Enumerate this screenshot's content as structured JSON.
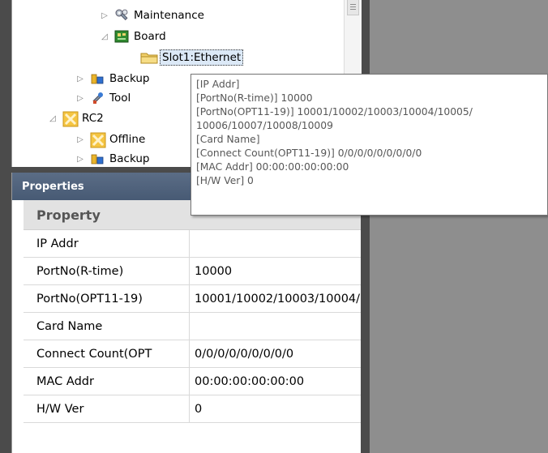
{
  "tree": {
    "items": [
      {
        "label": "Maintenance",
        "icon": "maintenance-icon",
        "expander": "collapsed"
      },
      {
        "label": "Board",
        "icon": "board-icon",
        "expander": "expanded"
      },
      {
        "label": "Slot1:Ethernet",
        "icon": "folder-icon",
        "expander": "none",
        "selected": true
      },
      {
        "label": "Backup",
        "icon": "backup-icon",
        "expander": "collapsed"
      },
      {
        "label": "Tool",
        "icon": "tool-icon",
        "expander": "collapsed"
      },
      {
        "label": "RC2",
        "icon": "robot-controller-icon",
        "expander": "expanded"
      },
      {
        "label": "Offline",
        "icon": "offline-icon",
        "expander": "collapsed"
      },
      {
        "label": "Backup",
        "icon": "backup-icon",
        "expander": "collapsed"
      }
    ]
  },
  "properties": {
    "title": "Properties",
    "column_header": "Property",
    "rows": [
      {
        "name": "IP Addr",
        "value": ""
      },
      {
        "name": "PortNo(R-time)",
        "value": "10000"
      },
      {
        "name": "PortNo(OPT11-19)",
        "value": "10001/10002/10003/10004/10005/10006/10007/10008/10009"
      },
      {
        "name": "Card Name",
        "value": ""
      },
      {
        "name": "Connect Count(OPT",
        "value": "0/0/0/0/0/0/0/0/0"
      },
      {
        "name": "MAC Addr",
        "value": "00:00:00:00:00:00"
      },
      {
        "name": "H/W Ver",
        "value": "0"
      }
    ]
  },
  "tooltip": {
    "lines": [
      "[IP Addr]",
      "[PortNo(R-time)]  10000",
      "[PortNo(OPT11-19)]  10001/10002/10003/10004/10005/",
      "10006/10007/10008/10009",
      "[Card Name]",
      "[Connect Count(OPT11-19)]  0/0/0/0/0/0/0/0/0",
      "[MAC Addr]  00:00:00:00:00:00",
      "[H/W Ver]   0"
    ]
  },
  "colors": {
    "header_bg": "#4f627c",
    "selection_bg": "#dce9f7",
    "frame": "#4b4b4b",
    "background": "#8e8e8e"
  }
}
